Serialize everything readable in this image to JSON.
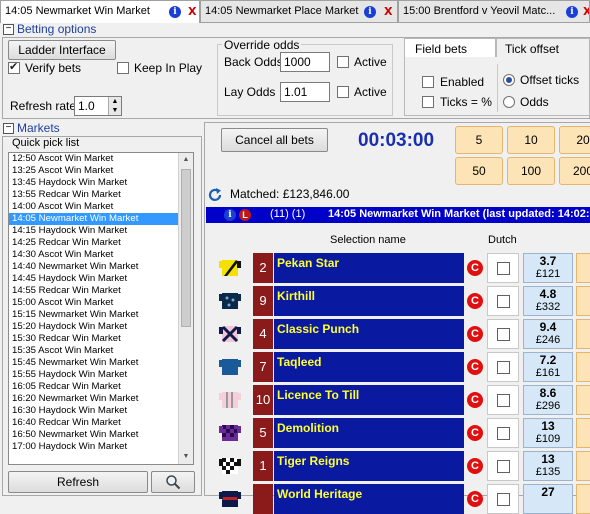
{
  "tabs": [
    {
      "label": "14:05 Newmarket Win Market",
      "active": true
    },
    {
      "label": "14:05 Newmarket Place Market",
      "active": false
    },
    {
      "label": "15:00 Brentford v Yeovil Matc...",
      "active": false
    }
  ],
  "betting_options": {
    "title": "Betting options",
    "ladder_button": "Ladder Interface",
    "verify_bets": "Verify bets",
    "keep_in_play": "Keep In Play",
    "refresh_rate_label": "Refresh rate",
    "refresh_rate_value": "1.0",
    "override": {
      "title": "Override odds",
      "back_label": "Back Odds",
      "back_value": "1000",
      "lay_label": "Lay Odds",
      "lay_value": "1.01",
      "active_label": "Active"
    },
    "field_tabs": [
      "Field bets",
      "Tick offset"
    ],
    "enabled": "Enabled",
    "ticks_pct": "Ticks = %",
    "offset_ticks": "Offset ticks",
    "odds": "Odds"
  },
  "markets": {
    "title": "Markets",
    "quick_pick": "Quick pick list",
    "items": [
      "12:50 Ascot Win Market",
      "13:25 Ascot Win Market",
      "13:45 Haydock Win Market",
      "13:55 Redcar Win Market",
      "14:00 Ascot Win Market",
      "14:05 Newmarket Win Market",
      "14:15 Haydock Win Market",
      "14:25 Redcar Win Market",
      "14:30 Ascot Win Market",
      "14:40 Newmarket Win Market",
      "14:45 Haydock Win Market",
      "14:55 Redcar Win Market",
      "15:00 Ascot Win Market",
      "15:15 Newmarket Win Market",
      "15:20 Haydock Win Market",
      "15:30 Redcar Win Market",
      "15:35 Ascot Win Market",
      "15:45 Newmarket Win Market",
      "15:55 Haydock Win Market",
      "16:05 Redcar Win Market",
      "16:20 Newmarket Win Market",
      "16:30 Haydock Win Market",
      "16:40 Redcar Win Market",
      "16:50 Newmarket Win Market",
      "17:00 Haydock Win Market"
    ],
    "selected_index": 5,
    "refresh_button": "Refresh"
  },
  "market_view": {
    "cancel_all": "Cancel all bets",
    "timer": "00:03:00",
    "stakes_row1": [
      "5",
      "10",
      "20"
    ],
    "stakes_row2": [
      "50",
      "100",
      "200"
    ],
    "matched": "Matched: £123,846.00",
    "info_count": "(11) (1)",
    "market_title": "14:05 Newmarket Win Market (last updated: 14:02:",
    "col_selection": "Selection name",
    "col_dutch": "Dutch",
    "colors": {
      "name_bg": "#0a1aa0",
      "name_fg": "#ffff30",
      "num_bg": "#8b1a1a"
    },
    "runners": [
      {
        "num": "2",
        "name": "Pekan Star",
        "price": "3.7",
        "size": "£121",
        "silk": "yellow-black-diagonal"
      },
      {
        "num": "9",
        "name": "Kirthill",
        "price": "4.8",
        "size": "£332",
        "silk": "navy-spots"
      },
      {
        "num": "4",
        "name": "Classic Punch",
        "price": "9.4",
        "size": "£246",
        "silk": "pink-navy-cross"
      },
      {
        "num": "7",
        "name": "Taqleed",
        "price": "7.2",
        "size": "£161",
        "silk": "blue-plain"
      },
      {
        "num": "10",
        "name": "Licence To Till",
        "price": "8.6",
        "size": "£296",
        "silk": "pink-stripes"
      },
      {
        "num": "5",
        "name": "Demolition",
        "price": "13",
        "size": "£109",
        "silk": "purple-check"
      },
      {
        "num": "1",
        "name": "Tiger Reigns",
        "price": "13",
        "size": "£135",
        "silk": "black-white-check"
      },
      {
        "num": "",
        "name": "World Heritage",
        "price": "27",
        "size": "",
        "silk": "navy-red"
      }
    ]
  }
}
